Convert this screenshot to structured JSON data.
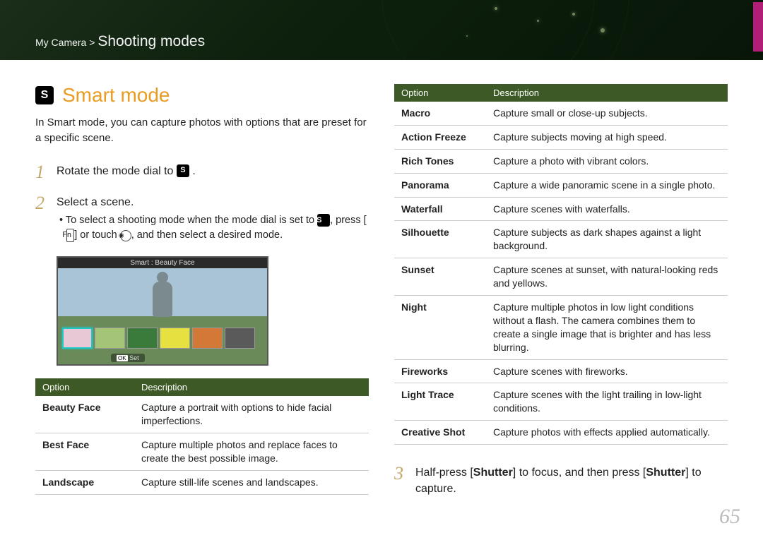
{
  "breadcrumb": {
    "prefix": "My Camera > ",
    "main": "Shooting modes"
  },
  "heading": "Smart mode",
  "intro": "In Smart mode, you can capture photos with options that are preset for a specific scene.",
  "step1_pre": "Rotate the mode dial to ",
  "step1_post": " .",
  "step2": "Select a scene.",
  "step2_sub_a": "To select a shooting mode when the mode dial is set to ",
  "step2_sub_b": ", press [",
  "step2_sub_c": "] or touch ",
  "step2_sub_d": ", and then select a desired mode.",
  "fn": "Fn",
  "shot_title": "Smart : Beauty Face",
  "set_label": "OK Set",
  "step3_a": "Half-press [",
  "step3_b": "Shutter",
  "step3_c": "] to focus, and then press [",
  "step3_d": "Shutter",
  "step3_e": "] to capture.",
  "table_headers": {
    "option": "Option",
    "desc": "Description"
  },
  "table_left": [
    {
      "name": "Beauty Face",
      "desc": "Capture a portrait with options to hide facial imperfections."
    },
    {
      "name": "Best Face",
      "desc": "Capture multiple photos and replace faces to create the best possible image."
    },
    {
      "name": "Landscape",
      "desc": "Capture still-life scenes and landscapes."
    }
  ],
  "table_right": [
    {
      "name": "Macro",
      "desc": "Capture small or close-up subjects."
    },
    {
      "name": "Action Freeze",
      "desc": "Capture subjects moving at high speed."
    },
    {
      "name": "Rich Tones",
      "desc": "Capture a photo with vibrant colors."
    },
    {
      "name": "Panorama",
      "desc": "Capture a wide panoramic scene in a single photo."
    },
    {
      "name": "Waterfall",
      "desc": "Capture scenes with waterfalls."
    },
    {
      "name": "Silhouette",
      "desc": "Capture subjects as dark shapes against a light background."
    },
    {
      "name": "Sunset",
      "desc": "Capture scenes at sunset, with natural-looking reds and yellows."
    },
    {
      "name": "Night",
      "desc": "Capture multiple photos in low light conditions without a flash. The camera combines them to create a single image that is brighter and has less blurring."
    },
    {
      "name": "Fireworks",
      "desc": "Capture scenes with fireworks."
    },
    {
      "name": "Light Trace",
      "desc": "Capture scenes with the light trailing in low-light conditions."
    },
    {
      "name": "Creative Shot",
      "desc": "Capture photos with effects applied automatically."
    }
  ],
  "page_number": "65",
  "thumb_colors": [
    "#e8c8d4",
    "#a4c478",
    "#3a7a3a",
    "#e6e040",
    "#d47838",
    "#5a5a5a"
  ]
}
